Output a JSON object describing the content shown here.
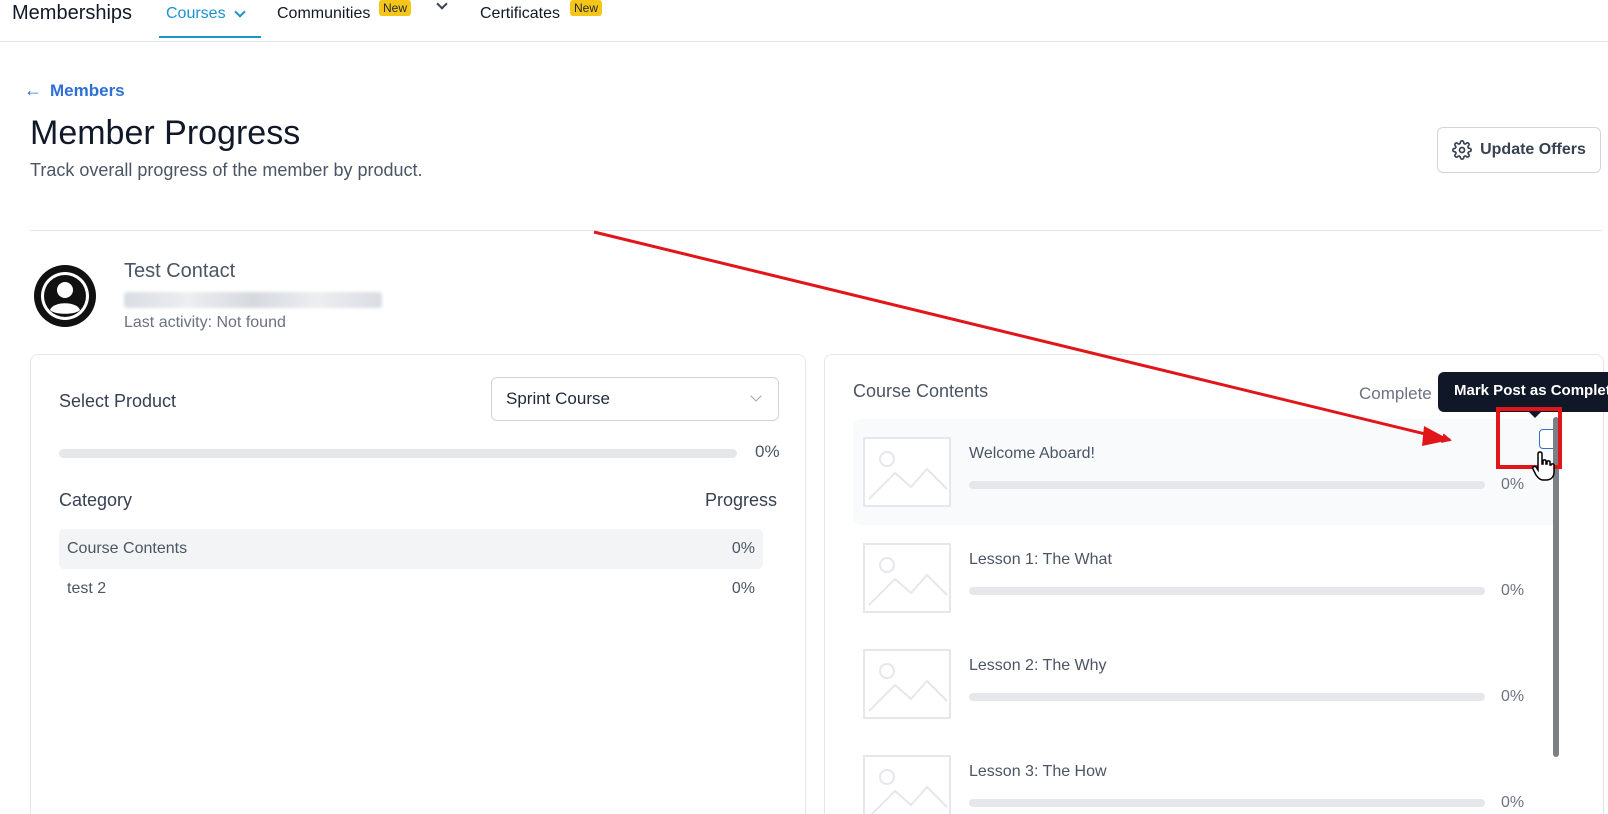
{
  "nav": {
    "brand": "Memberships",
    "items": [
      {
        "label": "Courses",
        "active": true,
        "badge": "",
        "has_dropdown": true
      },
      {
        "label": "Communities",
        "active": false,
        "badge": "New",
        "has_dropdown": true
      },
      {
        "label": "Certificates",
        "active": false,
        "badge": "New",
        "has_dropdown": false
      }
    ],
    "accent_color": "#1a93d1"
  },
  "header": {
    "back_label": "Members",
    "title": "Member Progress",
    "subtitle": "Track overall progress of the member by product.",
    "update_button": "Update Offers"
  },
  "contact": {
    "name": "Test Contact",
    "last_activity": "Last activity: Not found"
  },
  "product_panel": {
    "select_label": "Select Product",
    "selected_product": "Sprint Course",
    "overall_progress_label": "0%",
    "overall_progress": 0,
    "category_header": "Category",
    "progress_header": "Progress",
    "categories": [
      {
        "name": "Course Contents",
        "progress": "0%",
        "active": true
      },
      {
        "name": "test 2",
        "progress": "0%",
        "active": false
      }
    ]
  },
  "contents_panel": {
    "title": "Course Contents",
    "complete_label": "Complete",
    "lessons": [
      {
        "title": "Welcome Aboard!",
        "progress_label": "0%",
        "progress": 0
      },
      {
        "title": "Lesson 1: The What",
        "progress_label": "0%",
        "progress": 0
      },
      {
        "title": "Lesson 2: The Why",
        "progress_label": "0%",
        "progress": 0
      },
      {
        "title": "Lesson 3: The How",
        "progress_label": "0%",
        "progress": 0
      }
    ]
  },
  "tooltip": {
    "text": "Mark Post as Complete"
  },
  "annotation_color": "#e0161b"
}
